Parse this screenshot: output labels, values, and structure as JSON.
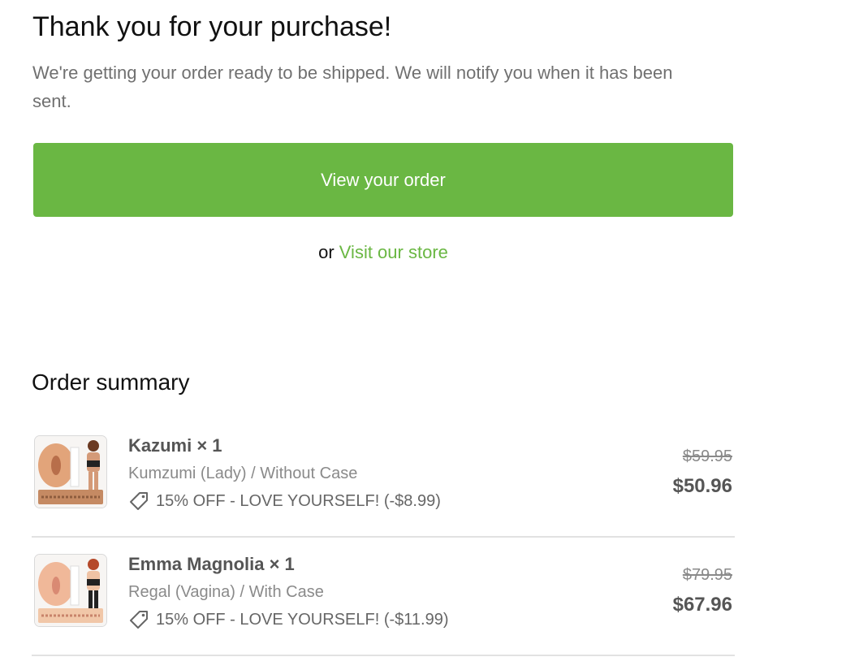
{
  "header": {
    "title": "Thank you for your purchase!",
    "subtitle": "We're getting your order ready to be shipped. We will notify you when it has been sent."
  },
  "actions": {
    "view_order_label": "View your order",
    "or_text": "or",
    "visit_store_label": "Visit our store"
  },
  "summary": {
    "title": "Order summary",
    "items": [
      {
        "name": "Kazumi × 1",
        "variant": "Kumzumi (Lady) / Without Case",
        "discount": "15% OFF - LOVE YOURSELF! (-$8.99)",
        "original_price": "$59.95",
        "price": "$50.96",
        "thumb_icon": "product-thumbnail"
      },
      {
        "name": "Emma Magnolia × 1",
        "variant": "Regal (Vagina) / With Case",
        "discount": "15% OFF - LOVE YOURSELF! (-$11.99)",
        "original_price": "$79.95",
        "price": "$67.96",
        "thumb_icon": "product-thumbnail"
      }
    ]
  },
  "colors": {
    "accent": "#6ab743",
    "text_muted": "#707070",
    "divider": "#e2e2e2"
  }
}
